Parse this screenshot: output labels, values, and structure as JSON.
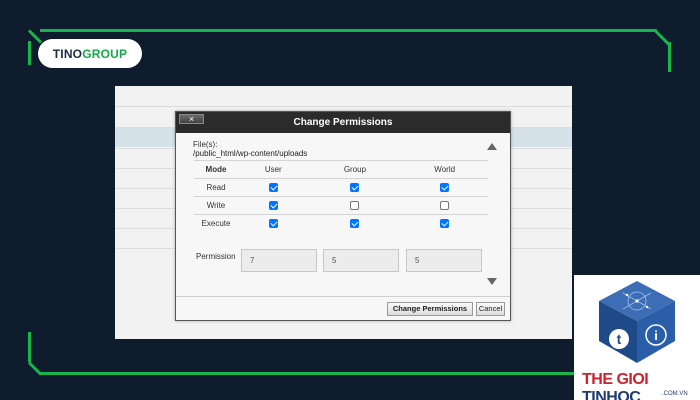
{
  "logo": {
    "part1": "TINO",
    "part2": "GROUP"
  },
  "dialog": {
    "title": "Change Permissions",
    "close_symbol": "×",
    "files_label": "File(s):",
    "files_path": "/public_html/wp-content/uploads",
    "columns": [
      "Mode",
      "User",
      "Group",
      "World"
    ],
    "rows": [
      {
        "label": "Read",
        "user": true,
        "group": true,
        "world": true
      },
      {
        "label": "Write",
        "user": true,
        "group": false,
        "world": false
      },
      {
        "label": "Execute",
        "user": true,
        "group": true,
        "world": true
      }
    ],
    "permission_label": "Permission",
    "permission_values": {
      "user": "7",
      "group": "5",
      "world": "5"
    },
    "buttons": {
      "change": "Change Permissions",
      "cancel": "Cancel"
    }
  },
  "brand": {
    "part1": "THE GIOI",
    "part2": "TINHOC",
    "domain": ".COM.VN"
  },
  "colors": {
    "background": "#0f1c2e",
    "accent_green": "#17b64a",
    "checkbox_blue": "#0075ff",
    "brand_red": "#d11f2b",
    "brand_navy": "#1e3a6e"
  },
  "icons": {
    "close": "close-icon",
    "scroll_up": "triangle-up-icon",
    "scroll_down": "triangle-down-icon"
  }
}
